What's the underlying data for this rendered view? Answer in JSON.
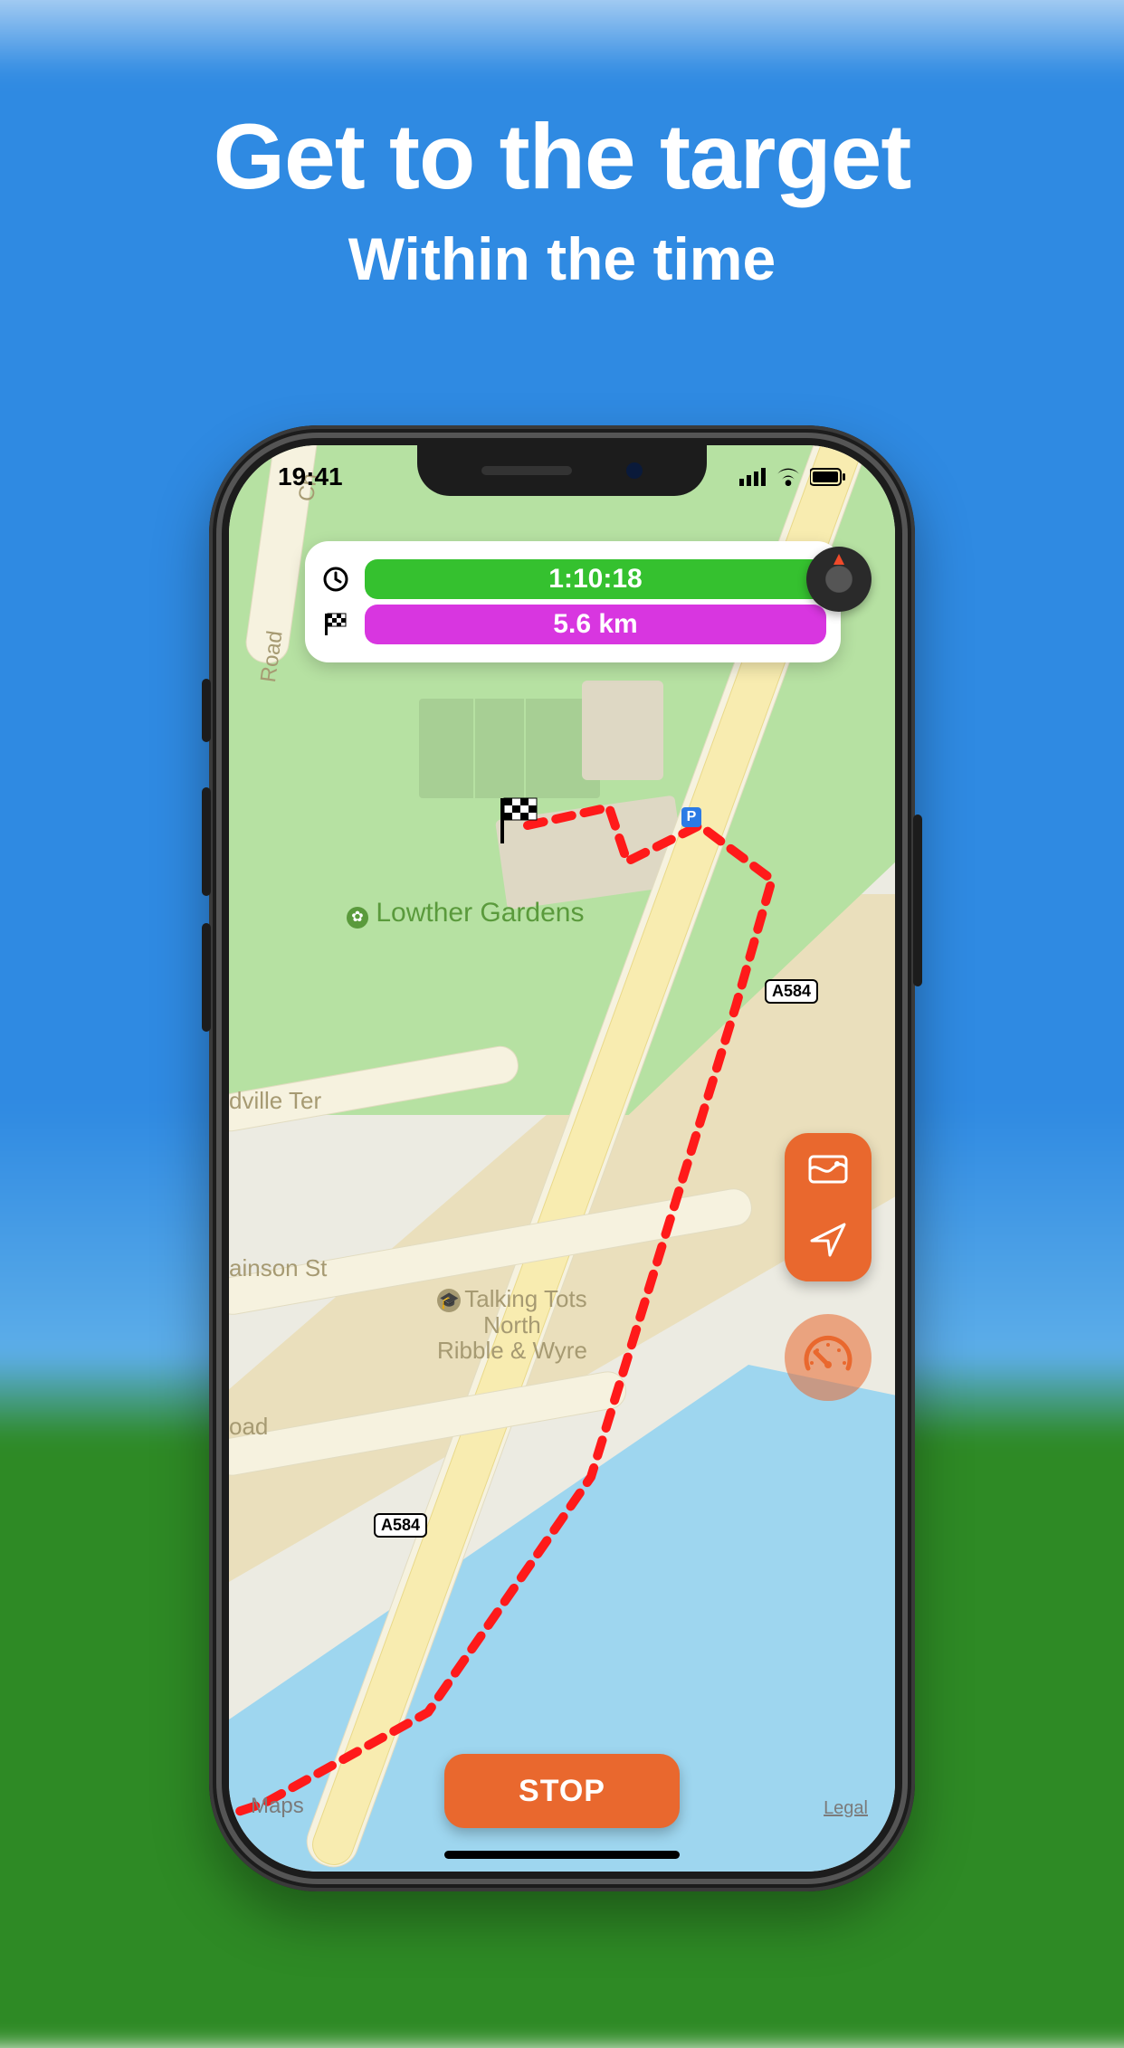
{
  "promo": {
    "title": "Get to the target",
    "subtitle": "Within the time"
  },
  "status": {
    "time": "19:41"
  },
  "hud": {
    "timer": "1:10:18",
    "distance": "5.6 km"
  },
  "map": {
    "park_name": "Lowther Gardens",
    "poi_name": "Talking Tots\nNorth\nRibble & Wyre",
    "route_badge": "A584",
    "streets": {
      "ter": "dville Ter",
      "st": "ainson St",
      "oad": "oad",
      "church": "Ch",
      "road_top": "Road"
    },
    "credit": "Maps",
    "legal": "Legal"
  },
  "controls": {
    "stop": "STOP"
  },
  "colors": {
    "accent": "#e9682e",
    "timer": "#35c12f",
    "distance": "#d836e0"
  }
}
